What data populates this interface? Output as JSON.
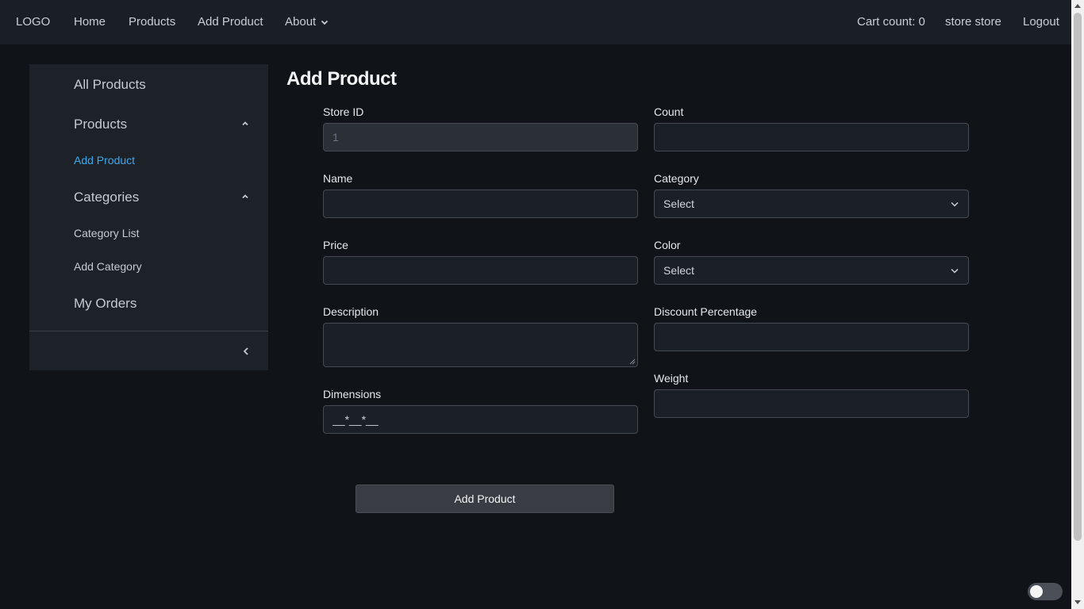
{
  "nav": {
    "logo": "LOGO",
    "home": "Home",
    "products": "Products",
    "add_product": "Add Product",
    "about": "About",
    "cart": "Cart count: 0",
    "user": "store store",
    "logout": "Logout"
  },
  "sidebar": {
    "all_products": "All Products",
    "products": "Products",
    "add_product": "Add Product",
    "categories": "Categories",
    "category_list": "Category List",
    "add_category": "Add Category",
    "my_orders": "My Orders"
  },
  "form": {
    "title": "Add Product",
    "store_id": {
      "label": "Store ID",
      "value": "1"
    },
    "count": {
      "label": "Count",
      "value": ""
    },
    "name": {
      "label": "Name",
      "value": ""
    },
    "category": {
      "label": "Category",
      "value": "Select"
    },
    "price": {
      "label": "Price",
      "value": ""
    },
    "color": {
      "label": "Color",
      "value": "Select"
    },
    "description": {
      "label": "Description",
      "value": ""
    },
    "discount": {
      "label": "Discount Percentage",
      "value": ""
    },
    "dimensions": {
      "label": "Dimensions",
      "value": "__*__*__"
    },
    "weight": {
      "label": "Weight",
      "value": ""
    },
    "submit": "Add Product"
  },
  "colors": {
    "accent": "#3ea8ee",
    "background": "#101419",
    "panel": "#1d2128"
  }
}
